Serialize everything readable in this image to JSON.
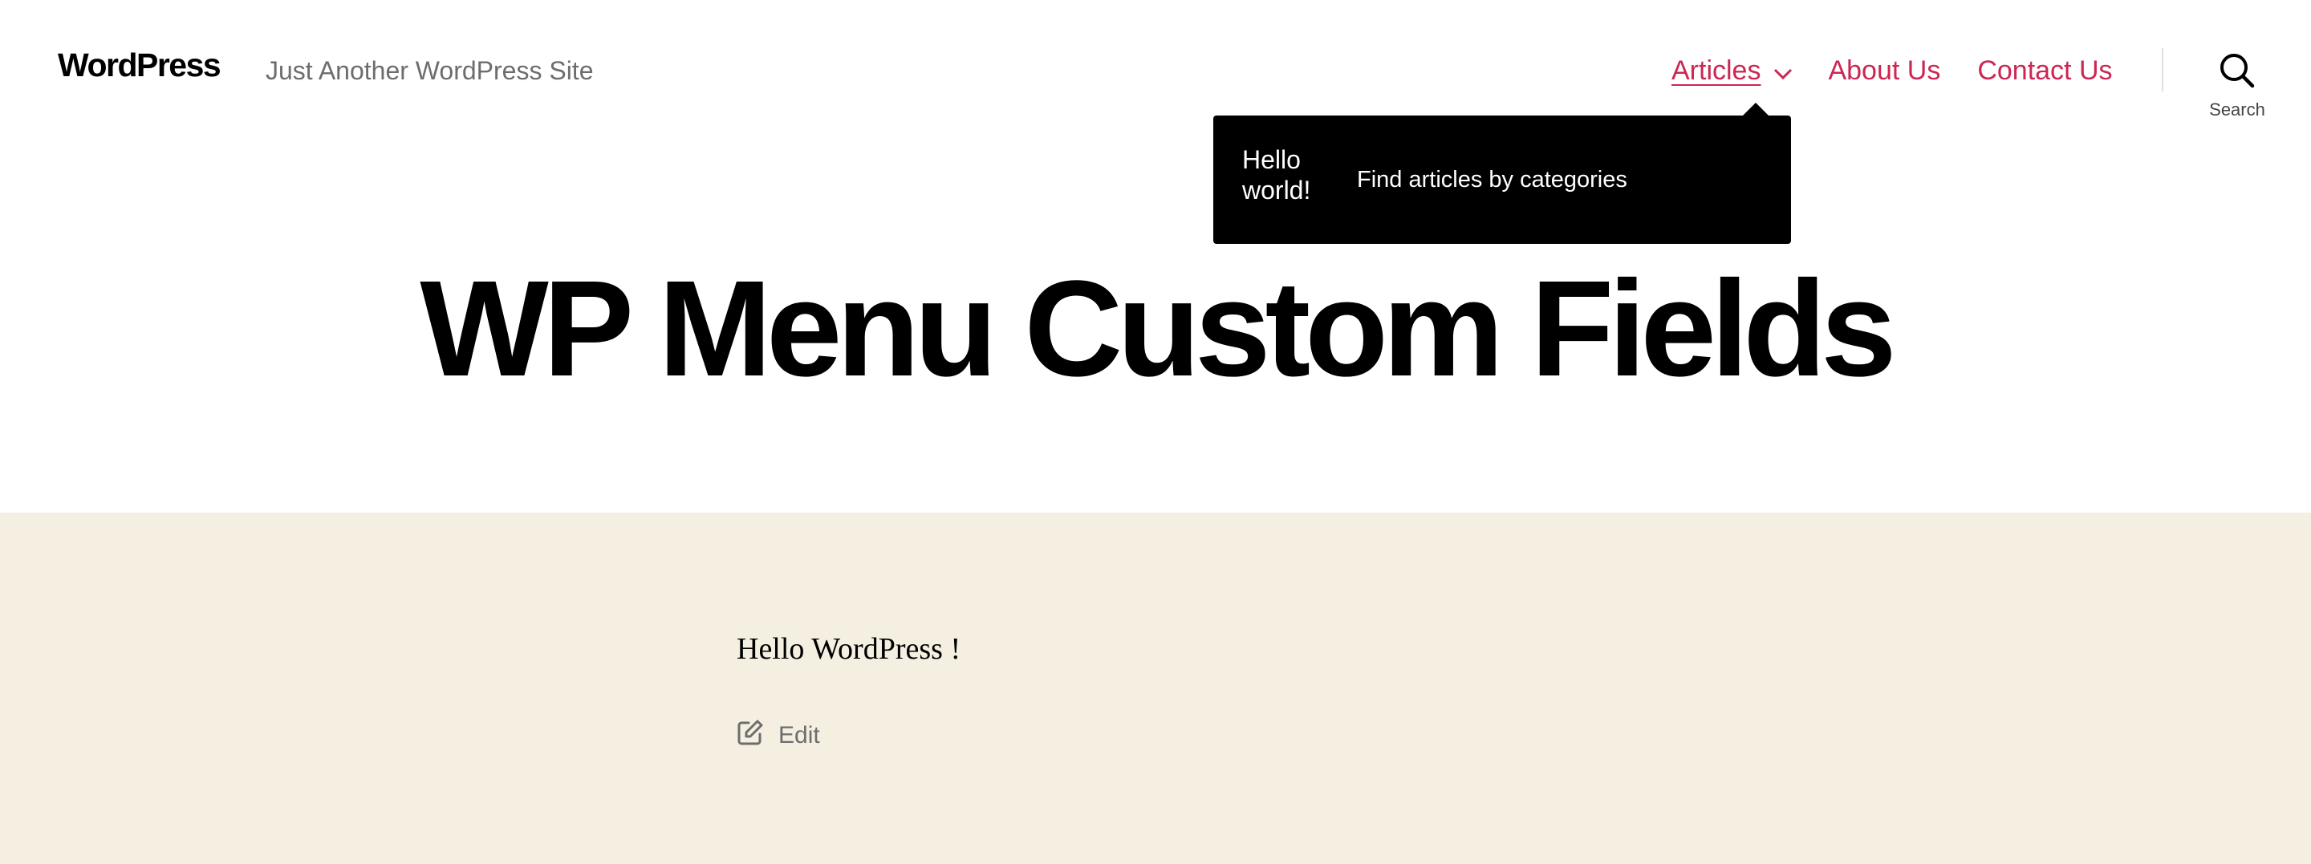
{
  "header": {
    "site_title": "WordPress",
    "tagline": "Just Another WordPress Site",
    "menu": {
      "articles": "Articles",
      "about": "About Us",
      "contact": "Contact Us"
    },
    "search_label": "Search"
  },
  "submenu": {
    "item_label": "Hello world!",
    "item_description": "Find articles by categories"
  },
  "page": {
    "title": "WP Menu Custom Fields"
  },
  "content": {
    "body_text": "Hello WordPress !",
    "edit_label": "Edit"
  },
  "colors": {
    "accent": "#cd2653",
    "content_background": "#f4efe1",
    "submenu_background": "#000000"
  },
  "icons": {
    "dropdown": "chevron-down-icon",
    "search": "search-icon",
    "edit": "edit-icon"
  }
}
